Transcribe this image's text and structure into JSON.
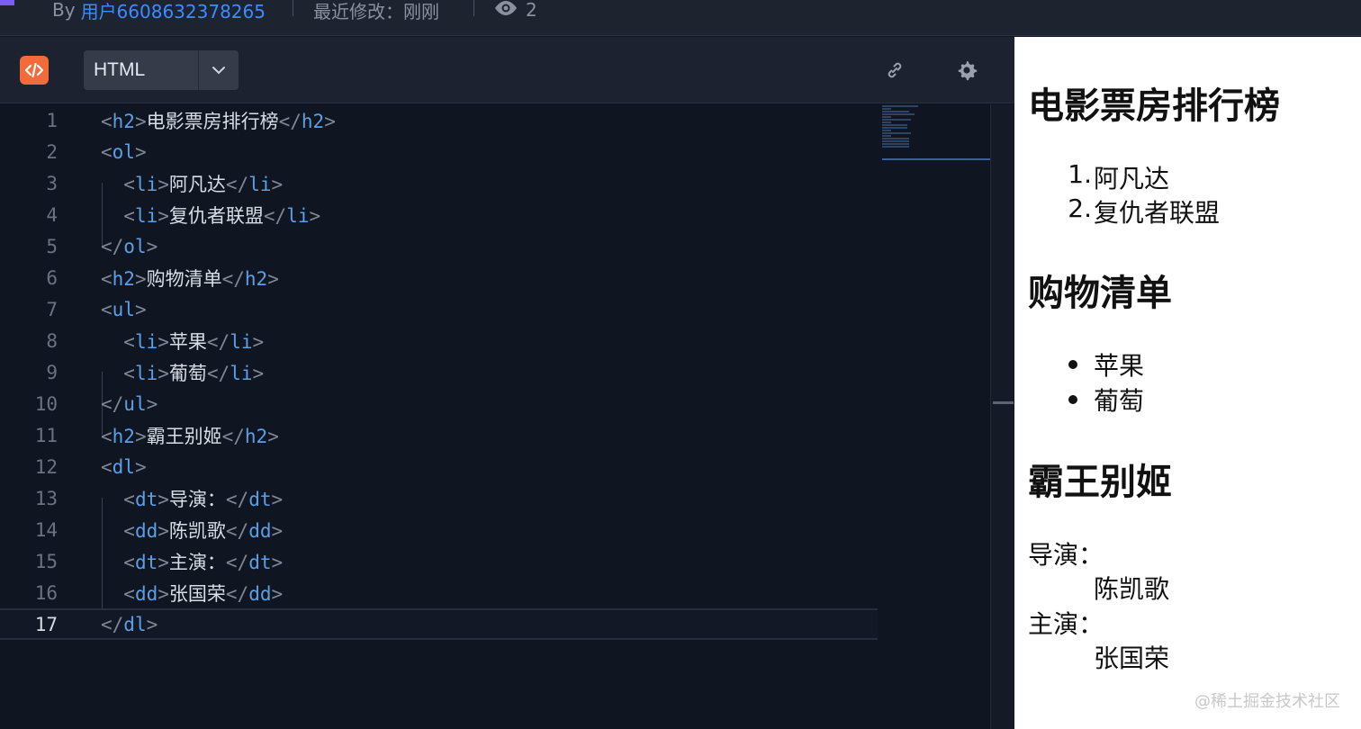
{
  "topbar": {
    "by_label": "By",
    "author": "用户6608632378265",
    "modified": "最近修改：刚刚",
    "view_count": "2"
  },
  "editor": {
    "language": "HTML",
    "lines": [
      "<h2>电影票房排行榜</h2>",
      "<ol>",
      "  <li>阿凡达</li>",
      "  <li>复仇者联盟</li>",
      "</ol>",
      "<h2>购物清单</h2>",
      "<ul>",
      "  <li>苹果</li>",
      "  <li>葡萄</li>",
      "</ul>",
      "<h2>霸王别姬</h2>",
      "<dl>",
      "  <dt>导演：</dt>",
      "  <dd>陈凯歌</dd>",
      "  <dt>主演：</dt>",
      "  <dd>张国荣</dd>",
      "</dl>"
    ],
    "line_numbers": [
      "1",
      "2",
      "3",
      "4",
      "5",
      "6",
      "7",
      "8",
      "9",
      "10",
      "11",
      "12",
      "13",
      "14",
      "15",
      "16",
      "17"
    ],
    "active_line": 17
  },
  "preview": {
    "h2_1": "电影票房排行榜",
    "ol_items": [
      "1.",
      "阿凡达",
      "2.",
      "复仇者联盟"
    ],
    "h2_2": "购物清单",
    "ul_items": [
      "苹果",
      "葡萄"
    ],
    "h2_3": "霸王别姬",
    "dl": {
      "dt1": "导演：",
      "dd1": "陈凯歌",
      "dt2": "主演：",
      "dd2": "张国荣"
    },
    "watermark": "@稀土掘金技术社区"
  },
  "icons": {
    "logo": "code-icon",
    "dropdown": "chevron-down-icon",
    "link": "link-icon",
    "settings": "gear-icon",
    "views": "eye-icon"
  },
  "colors": {
    "accent_orange": "#f26b3a",
    "author_link": "#3d8bff",
    "tag": "#5aa0e8"
  }
}
